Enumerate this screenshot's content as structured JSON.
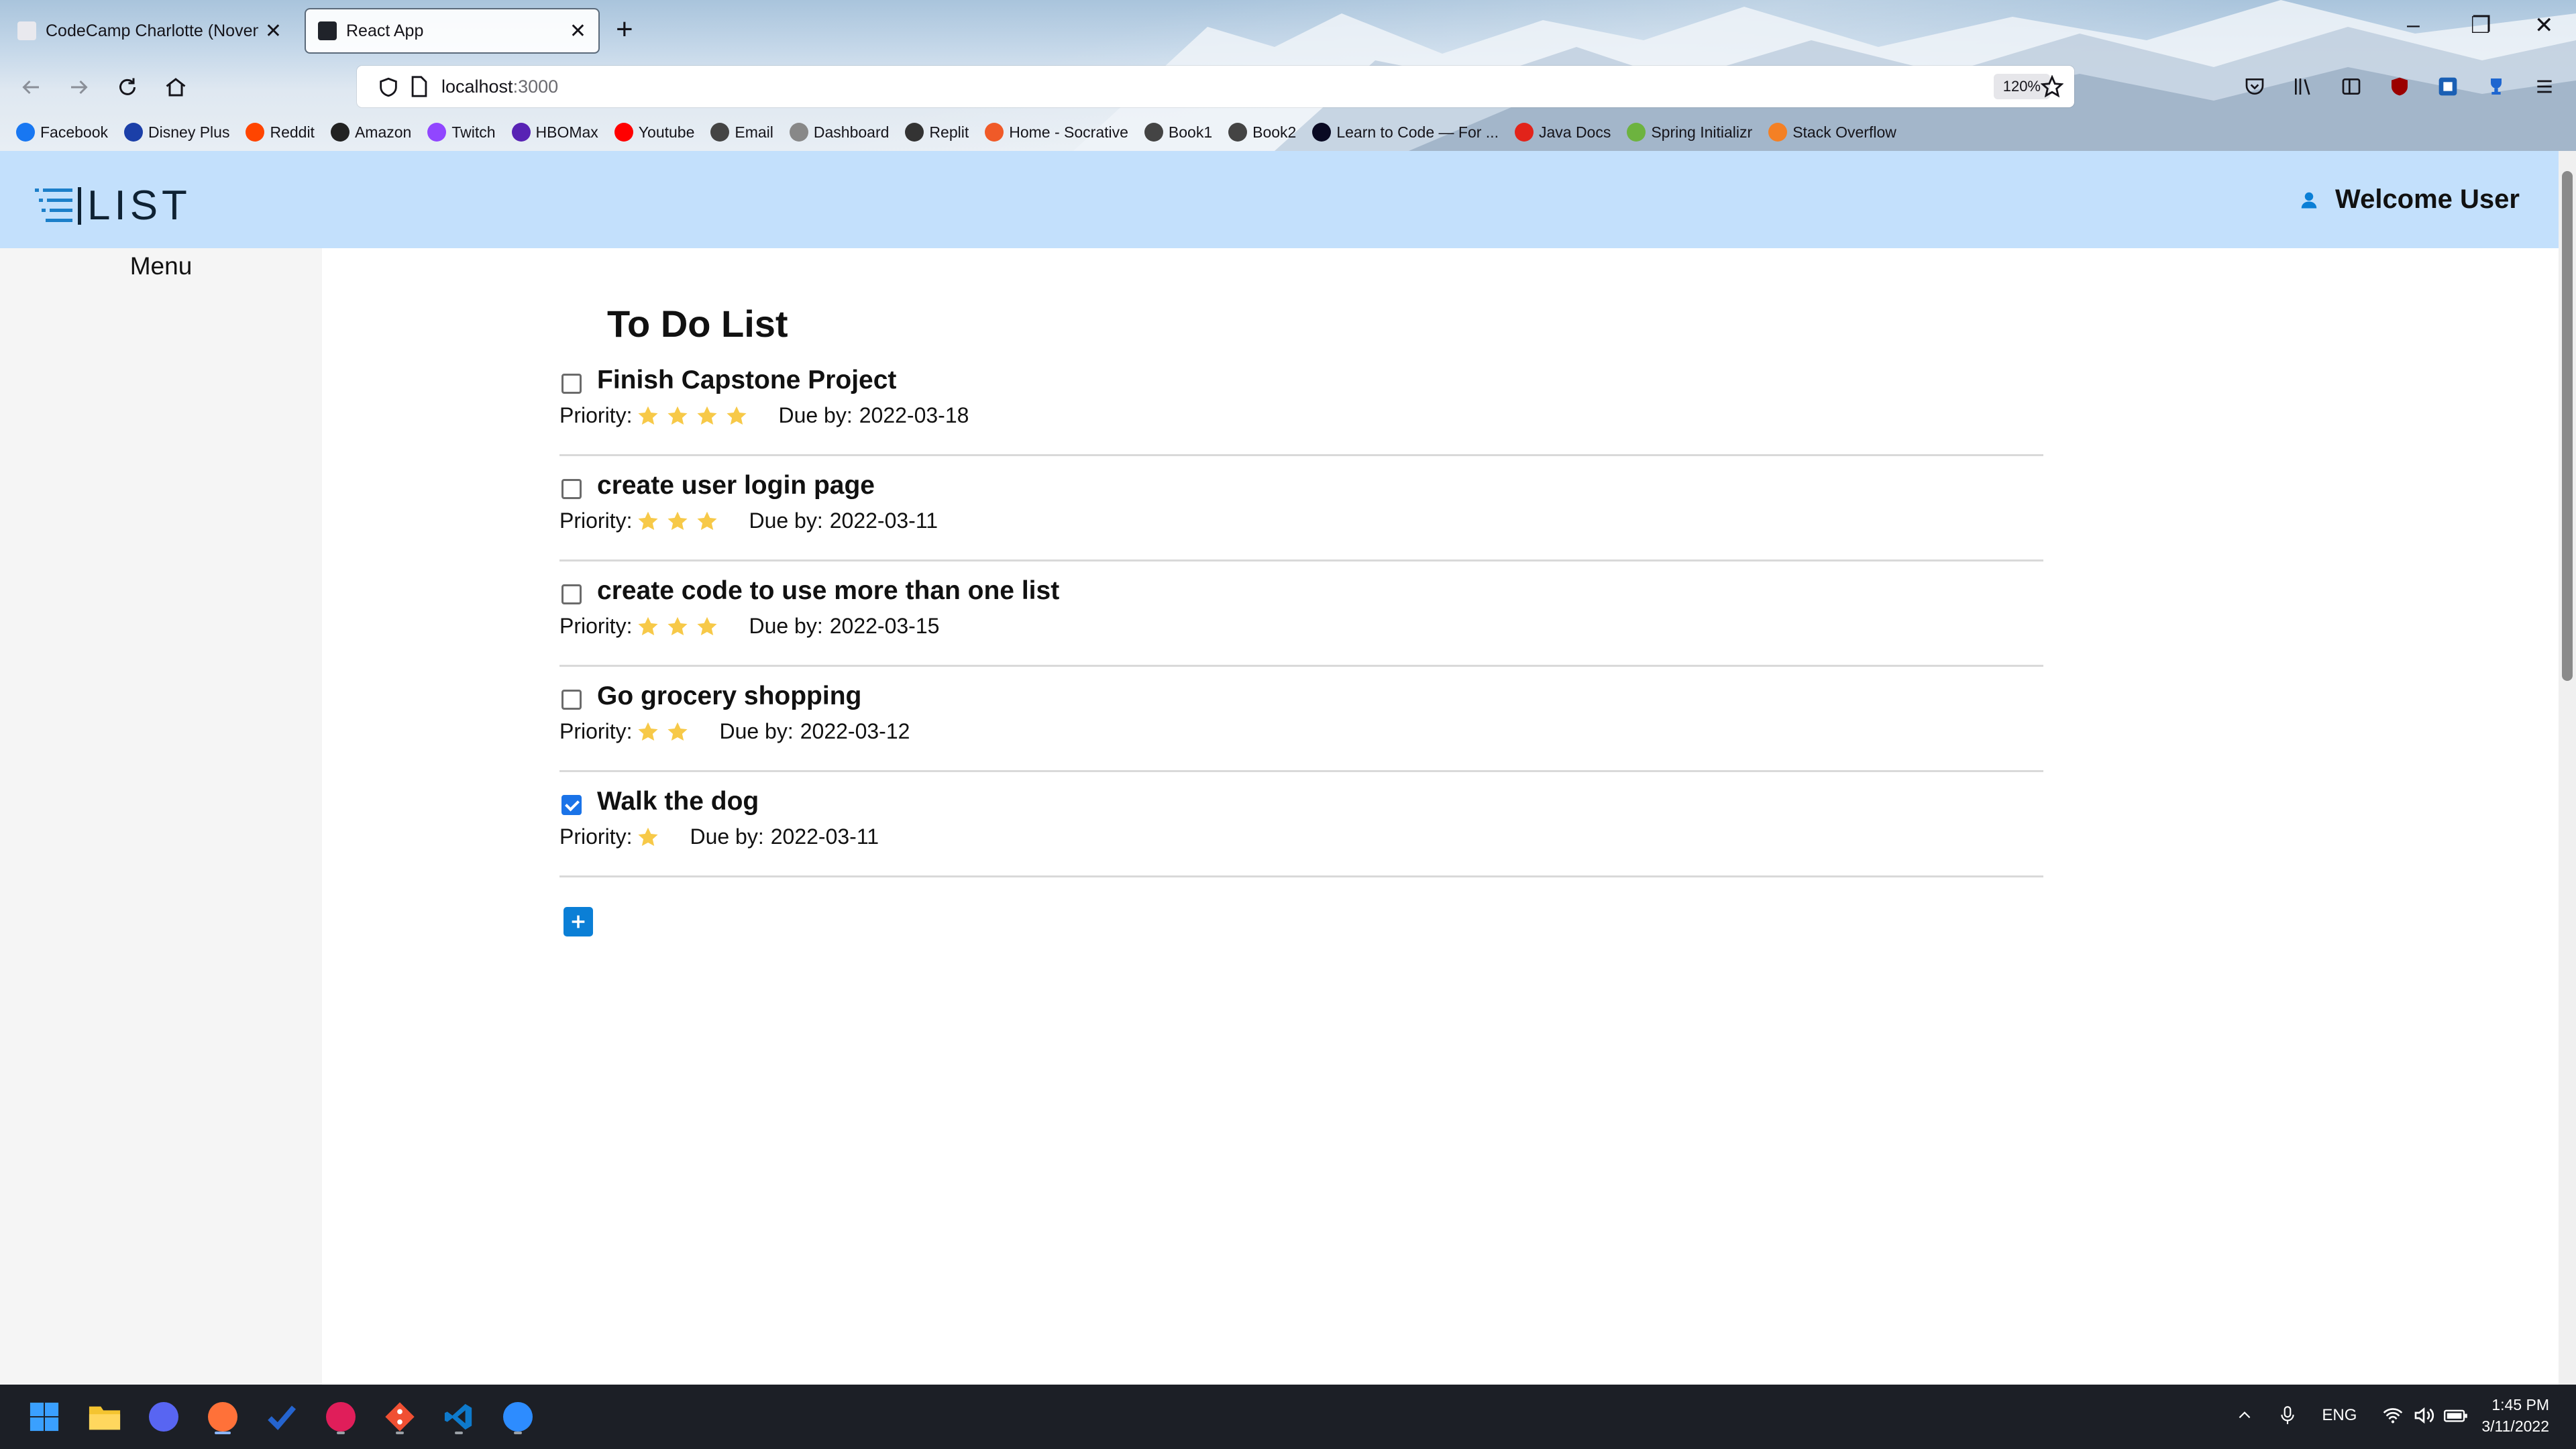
{
  "browser": {
    "tabs": [
      {
        "title": "CodeCamp Charlotte (Novembe",
        "active": false
      },
      {
        "title": "React App",
        "active": true
      }
    ],
    "url_host": "localhost",
    "url_port": ":3000",
    "zoom": "120%",
    "bookmarks": [
      {
        "label": "Facebook",
        "icon": "facebook-icon",
        "color": "#1877f2"
      },
      {
        "label": "Disney Plus",
        "icon": "disney-icon",
        "color": "#1b3fa8"
      },
      {
        "label": "Reddit",
        "icon": "reddit-icon",
        "color": "#ff4500"
      },
      {
        "label": "Amazon",
        "icon": "amazon-icon",
        "color": "#222222"
      },
      {
        "label": "Twitch",
        "icon": "twitch-icon",
        "color": "#9146ff"
      },
      {
        "label": "HBOMax",
        "icon": "hbomax-icon",
        "color": "#5822b4"
      },
      {
        "label": "Youtube",
        "icon": "youtube-icon",
        "color": "#ff0000"
      },
      {
        "label": "Email",
        "icon": "globe-icon",
        "color": "#444444"
      },
      {
        "label": "Dashboard",
        "icon": "dashboard-icon",
        "color": "#888888"
      },
      {
        "label": "Replit",
        "icon": "replit-icon",
        "color": "#333333"
      },
      {
        "label": "Home - Socrative",
        "icon": "socrative-icon",
        "color": "#f05a28"
      },
      {
        "label": "Book1",
        "icon": "globe-icon",
        "color": "#444444"
      },
      {
        "label": "Book2",
        "icon": "globe-icon",
        "color": "#444444"
      },
      {
        "label": "Learn to Code — For ...",
        "icon": "freecodecamp-icon",
        "color": "#0a0a23"
      },
      {
        "label": "Java Docs",
        "icon": "oracle-icon",
        "color": "#e2231a"
      },
      {
        "label": "Spring Initializr",
        "icon": "spring-icon",
        "color": "#6db33f"
      },
      {
        "label": "Stack Overflow",
        "icon": "stackoverflow-icon",
        "color": "#f48024"
      }
    ]
  },
  "app": {
    "logo_text": "LIST",
    "welcome": "Welcome User",
    "menu_title": "Menu",
    "page_title": "To Do List",
    "priority_label": "Priority:",
    "due_label": "Due by:",
    "todos": [
      {
        "title": "Finish Capstone Project",
        "priority": 4,
        "due": "2022-03-18",
        "done": false
      },
      {
        "title": "create user login page",
        "priority": 3,
        "due": "2022-03-11",
        "done": false
      },
      {
        "title": "create code to use more than one list",
        "priority": 3,
        "due": "2022-03-15",
        "done": false
      },
      {
        "title": "Go grocery shopping",
        "priority": 2,
        "due": "2022-03-12",
        "done": false
      },
      {
        "title": "Walk the dog",
        "priority": 1,
        "due": "2022-03-11",
        "done": true
      }
    ],
    "colors": {
      "header_bg": "#c3e0fc",
      "sidebar_bg": "#f5f5f5",
      "accent": "#0b7fd6",
      "star": "#f7c948"
    }
  },
  "taskbar": {
    "apps": [
      "windows-start-icon",
      "file-explorer-icon",
      "discord-icon",
      "firefox-icon",
      "todo-icon",
      "slack-icon",
      "git-icon",
      "vscode-icon",
      "zoom-icon"
    ],
    "language": "ENG",
    "time": "1:45 PM",
    "date": "3/11/2022"
  }
}
